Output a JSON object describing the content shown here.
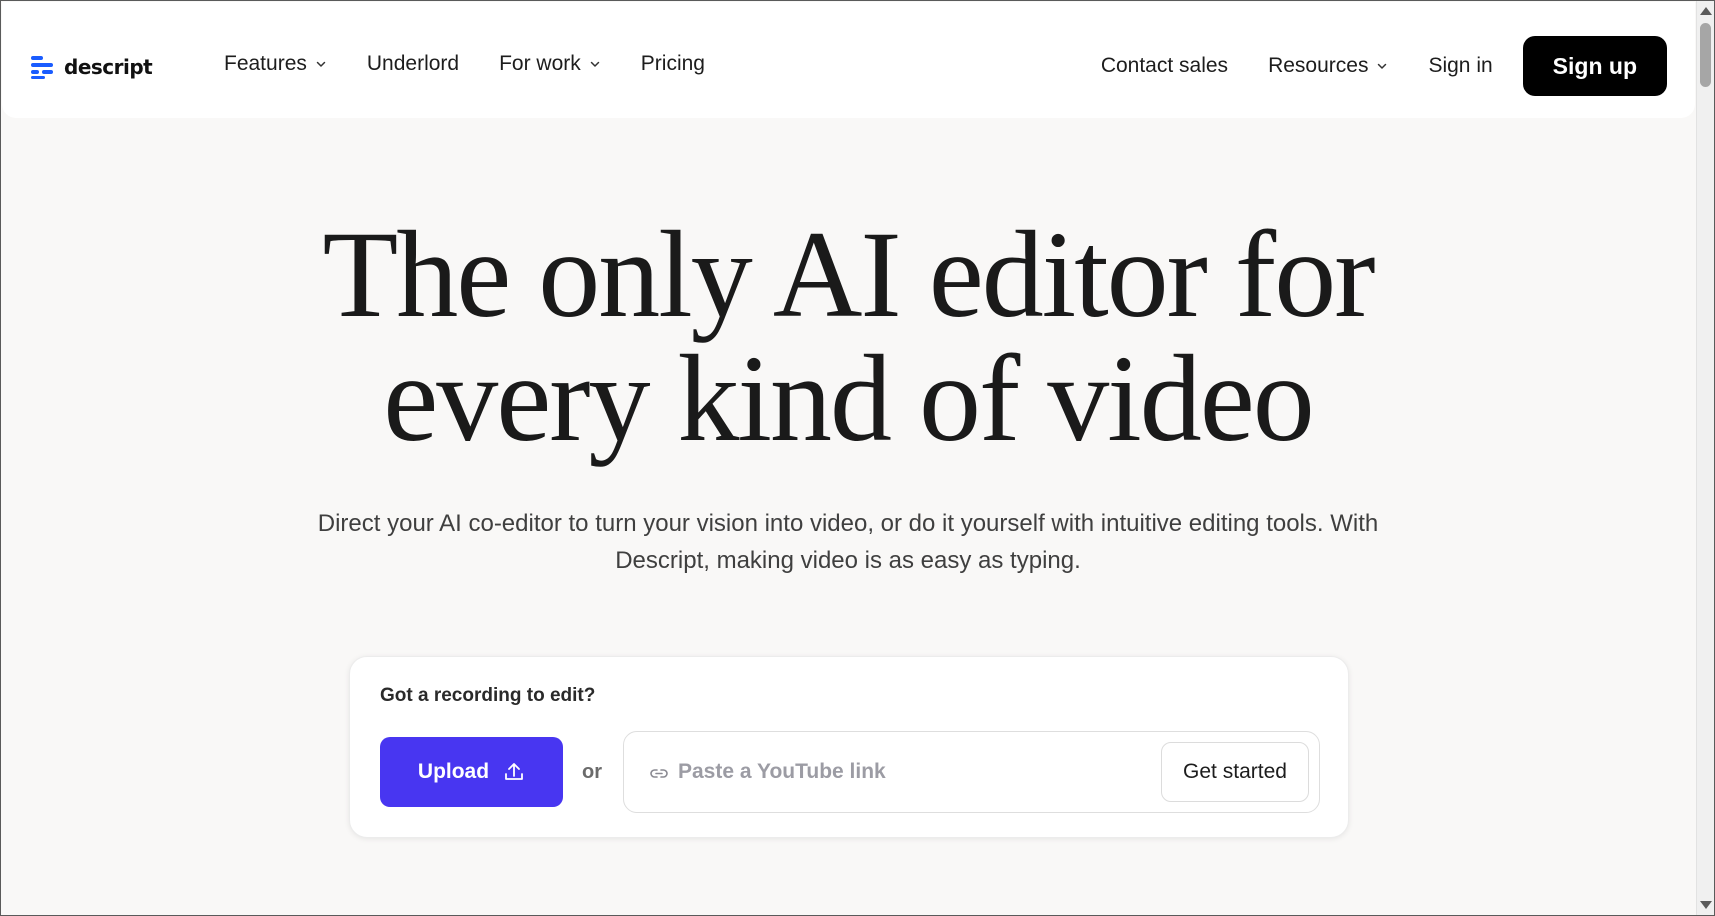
{
  "brand": {
    "name": "descript",
    "accent_color": "#1a5cff"
  },
  "nav": {
    "left": [
      {
        "label": "Features",
        "has_dropdown": true
      },
      {
        "label": "Underlord",
        "has_dropdown": false
      },
      {
        "label": "For work",
        "has_dropdown": true
      },
      {
        "label": "Pricing",
        "has_dropdown": false
      }
    ],
    "right": {
      "contact_sales": "Contact sales",
      "resources": "Resources",
      "sign_in": "Sign in",
      "sign_up": "Sign up"
    }
  },
  "hero": {
    "title_line1": "The only AI editor for",
    "title_line2": "every kind of video",
    "subtitle": "Direct your AI co-editor to turn your vision into video, or do it yourself with intuitive editing tools. With Descript, making video is as easy as typing."
  },
  "upload_card": {
    "label": "Got a recording to edit?",
    "upload_button": "Upload",
    "or_text": "or",
    "link_placeholder": "Paste a YouTube link",
    "link_value": "",
    "get_started_button": "Get started",
    "upload_color": "#4836f1"
  },
  "icons": {
    "logo": "descript-logo-icon",
    "dropdown": "chevron-down-icon",
    "upload": "upload-icon",
    "link": "link-icon"
  }
}
